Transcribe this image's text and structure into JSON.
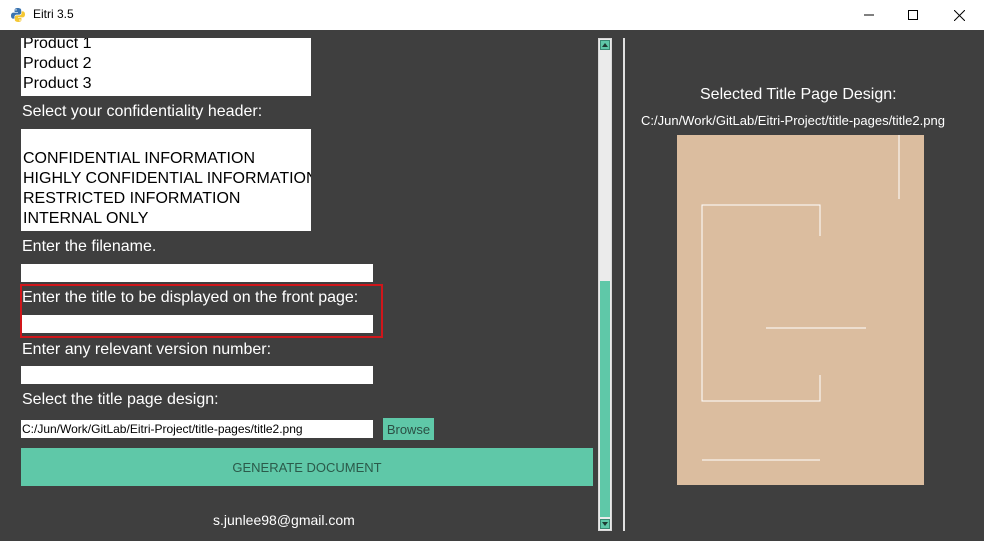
{
  "window": {
    "title": "Eitri 3.5"
  },
  "products": {
    "items": [
      "Product 1",
      "Product 2",
      "Product 3"
    ]
  },
  "confidentiality": {
    "label": "Select your confidentiality header:",
    "items": [
      "",
      "CONFIDENTIAL INFORMATION",
      "HIGHLY CONFIDENTIAL INFORMATION",
      "RESTRICTED INFORMATION",
      "INTERNAL ONLY"
    ]
  },
  "filename": {
    "label": "Enter the filename.",
    "value": ""
  },
  "front_title": {
    "label": "Enter the title to be displayed on the front page:",
    "value": ""
  },
  "version": {
    "label": "Enter any relevant version number:",
    "value": ""
  },
  "design": {
    "label": "Select the title page design:",
    "path_value": "C:/Jun/Work/GitLab/Eitri-Project/title-pages/title2.png",
    "browse_label": "Browse"
  },
  "generate": {
    "label": "GENERATE DOCUMENT"
  },
  "footer": {
    "email": "s.junlee98@gmail.com"
  },
  "preview": {
    "heading": "Selected Title Page Design:",
    "path": "C:/Jun/Work/GitLab/Eitri-Project/title-pages/title2.png"
  },
  "colors": {
    "accent": "#5fc8a8",
    "background": "#3f3f3f",
    "highlight": "#d0161a",
    "preview_bg": "#dbbd9f"
  },
  "icons": {
    "app": "python-icon",
    "minimize": "minimize-icon",
    "maximize": "maximize-icon",
    "close": "close-icon"
  }
}
